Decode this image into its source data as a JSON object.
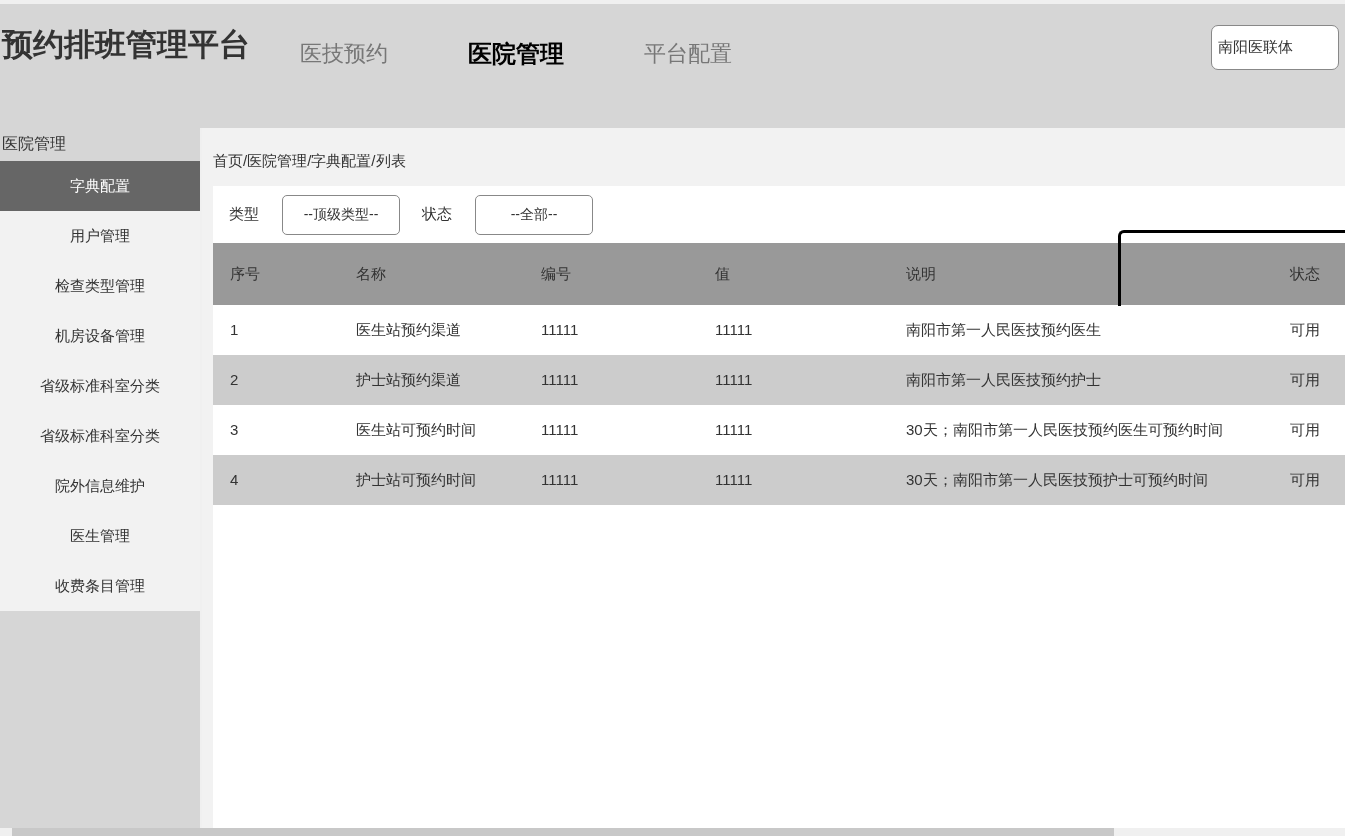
{
  "header": {
    "title": "预约排班管理平台",
    "tabs": [
      {
        "label": "医技预约",
        "selected": false
      },
      {
        "label": "医院管理",
        "selected": true
      },
      {
        "label": "平台配置",
        "selected": false
      }
    ],
    "org_select": {
      "value": "南阳医联体"
    }
  },
  "sidebar": {
    "title": "医院管理",
    "items": [
      {
        "label": "字典配置",
        "selected": true
      },
      {
        "label": "用户管理",
        "selected": false
      },
      {
        "label": "检查类型管理",
        "selected": false
      },
      {
        "label": "机房设备管理",
        "selected": false
      },
      {
        "label": "省级标准科室分类",
        "selected": false
      },
      {
        "label": "省级标准科室分类",
        "selected": false
      },
      {
        "label": "院外信息维护",
        "selected": false
      },
      {
        "label": "医生管理",
        "selected": false
      },
      {
        "label": "收费条目管理",
        "selected": false
      }
    ]
  },
  "breadcrumb": "首页/医院管理/字典配置/列表",
  "filters": [
    {
      "label": "类型",
      "value": "--顶级类型--"
    },
    {
      "label": "状态",
      "value": "--全部--"
    }
  ],
  "table": {
    "columns": [
      "序号",
      "名称",
      "编号",
      "值",
      "说明",
      "状态"
    ],
    "rows": [
      [
        "1",
        "医生站预约渠道",
        "11111",
        "11111",
        "南阳市第一人民医技预约医生",
        "可用"
      ],
      [
        "2",
        "护士站预约渠道",
        "11111",
        "11111",
        "南阳市第一人民医技预约护士",
        "可用"
      ],
      [
        "3",
        "医生站可预约时间",
        "11111",
        "11111",
        "30天；南阳市第一人民医技预约医生可预约时间",
        "可用"
      ],
      [
        "4",
        "护士站可预约时间",
        "11111",
        "11111",
        "30天；南阳市第一人民医技预护士可预约时间",
        "可用"
      ]
    ]
  }
}
